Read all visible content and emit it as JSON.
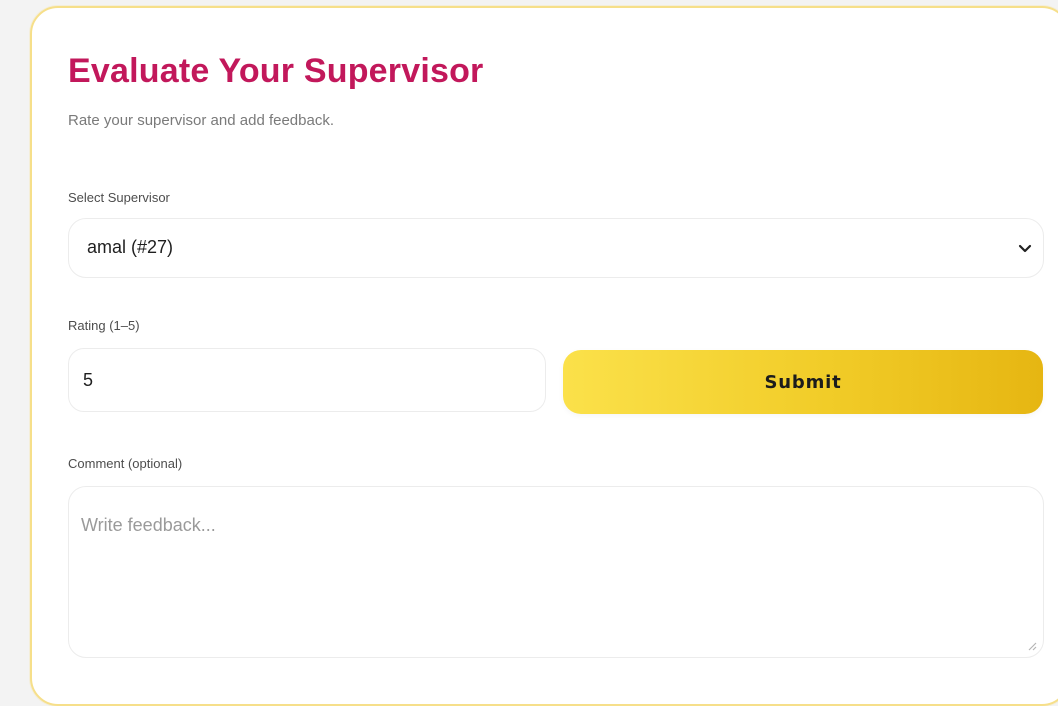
{
  "evaluation_form": {
    "title": "Evaluate Your Supervisor",
    "subtitle": "Rate your supervisor and add feedback.",
    "supervisor": {
      "label": "Select Supervisor",
      "selected_value": "amal (#27)"
    },
    "rating": {
      "label": "Rating (1–5)",
      "value": "5"
    },
    "submit_label": "Submit",
    "comment": {
      "label": "Comment (optional)",
      "placeholder": "Write feedback..."
    }
  },
  "colors": {
    "title": "#c2185b",
    "accent_yellow_start": "#fbe14a",
    "accent_yellow_end": "#e6b612",
    "card_border": "#f6df8a"
  },
  "icons": {
    "select_chevron": "chevron-down-icon",
    "textarea_resize": "resize-handle-icon"
  }
}
